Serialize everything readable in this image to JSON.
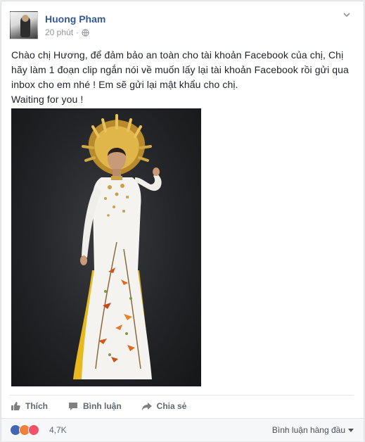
{
  "post": {
    "author": "Huong Pham",
    "time": "20 phút",
    "separator": "·",
    "privacy_icon": "globe-icon",
    "menu_icon": "chevron-down-icon",
    "text_lines": [
      "Chào chị Hương, để đảm bảo an toàn cho tài khoản Facebook của chị, Chị",
      "hãy làm 1 đoạn clip ngắn nói về muốn lấy lại tài khoản Facebook rồi gửi qua",
      "inbox cho em nhé ! Em sẽ gửi lại mật khẩu cho chị.",
      "Waiting for you !"
    ],
    "photo_icon": "photo-woman-ao-dai"
  },
  "actions": {
    "like_label": "Thích",
    "comment_label": "Bình luận",
    "share_label": "Chia sẻ"
  },
  "reactions": {
    "icons": [
      "like-reaction",
      "angry-reaction",
      "love-reaction"
    ],
    "count": "4,7K",
    "sort_label": "Bình luận hàng đầu",
    "sort_icon": "caret-down-icon"
  },
  "colors": {
    "link": "#365899",
    "meta": "#90949c",
    "action": "#616770",
    "like_blue": "#4267b2"
  }
}
